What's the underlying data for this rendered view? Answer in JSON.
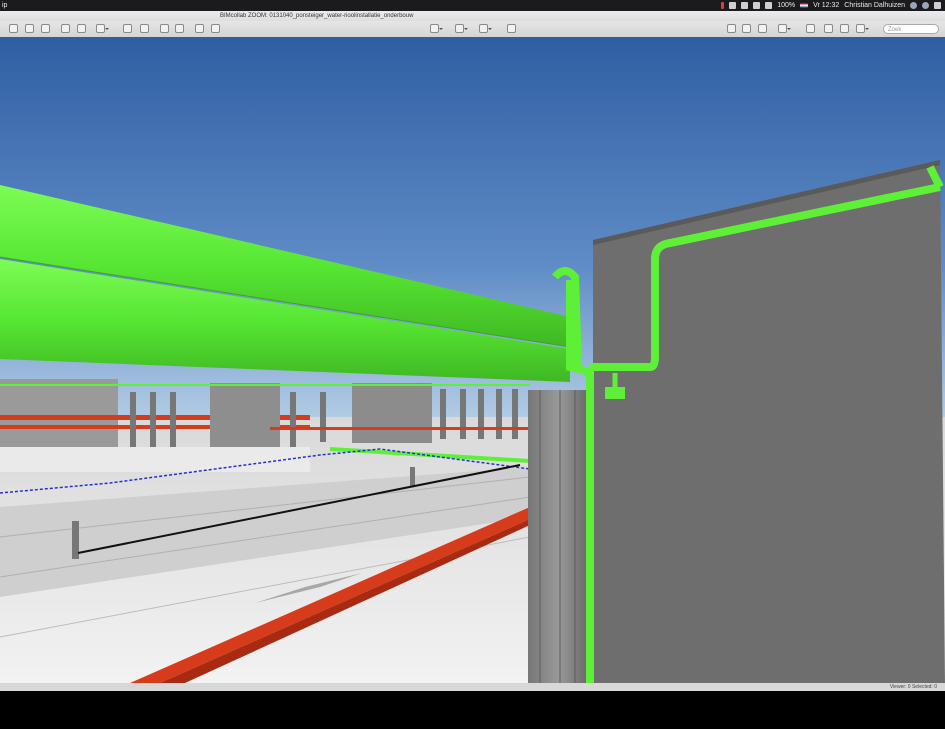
{
  "menubar": {
    "app_fragment": "ip",
    "clock": "Vr 12:32",
    "user": "Christian Dalhuizen",
    "battery": "100%"
  },
  "window": {
    "title": "BIMcollab ZOOM: 0131040_ponsteiger_water-rioolinstallatie_onderbouw"
  },
  "toolbar": {
    "search_placeholder": "Zoek"
  },
  "statusbar": {
    "text": "Viewer: 0  Selected: 0"
  },
  "colors": {
    "sky_top": "#3a66a8",
    "sky_bottom": "#a9c4e1",
    "pipe_green": "#5ef037",
    "wall_grey": "#6e6e6e",
    "floor_grey": "#dcdcdc",
    "red_beam": "#d63c1c"
  }
}
